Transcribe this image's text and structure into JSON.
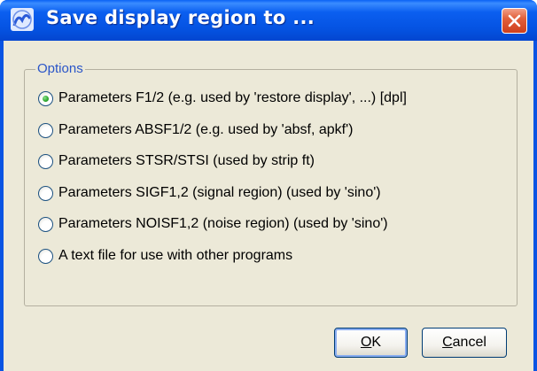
{
  "window": {
    "title": "Save display region to ..."
  },
  "options": {
    "legend": "Options",
    "items": [
      {
        "label": "Parameters F1/2 (e.g. used by 'restore display', ...) [dpl]",
        "checked": true
      },
      {
        "label": "Parameters ABSF1/2 (e.g. used by 'absf, apkf')",
        "checked": false
      },
      {
        "label": "Parameters STSR/STSI (used by strip ft)",
        "checked": false
      },
      {
        "label": "Parameters SIGF1,2 (signal region) (used by 'sino')",
        "checked": false
      },
      {
        "label": "Parameters NOISF1,2 (noise region) (used by 'sino')",
        "checked": false
      },
      {
        "label": "A text file for use with other programs",
        "checked": false
      }
    ]
  },
  "buttons": {
    "ok_mnemonic": "O",
    "ok_rest": "K",
    "cancel_mnemonic": "C",
    "cancel_rest": "ancel"
  },
  "icons": {
    "app": "app-logo-icon",
    "close": "close-icon"
  },
  "colors": {
    "titlebar": "#0553e2",
    "client": "#ece9d8",
    "legend": "#2a55c8",
    "radio_checked": "#2ea82e"
  }
}
